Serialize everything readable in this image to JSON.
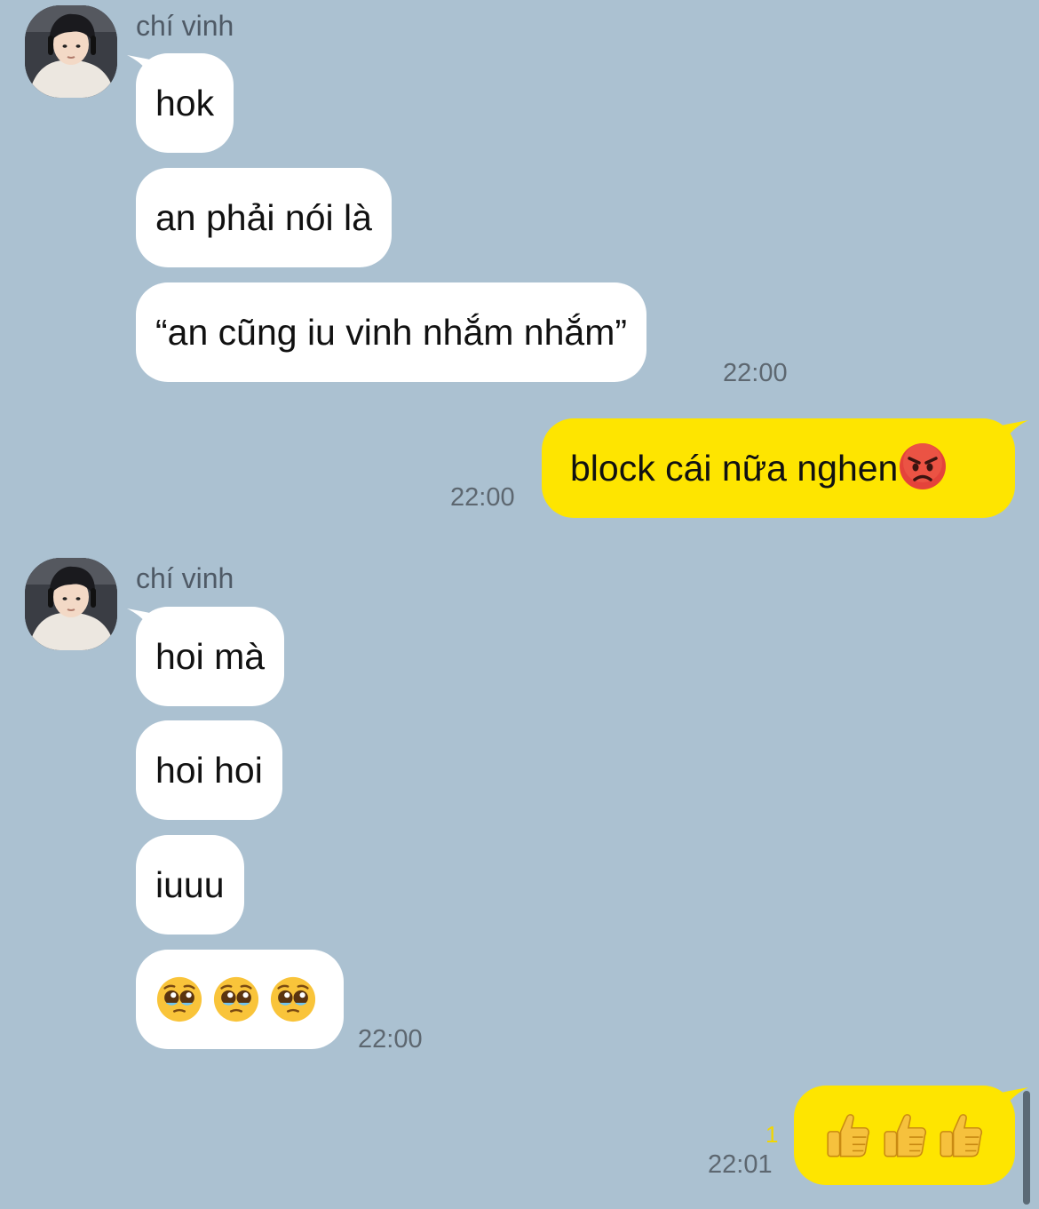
{
  "colors": {
    "background": "#abc1d1",
    "incoming_bubble": "#ffffff",
    "outgoing_bubble": "#fee500",
    "unread_count": "#f2d600"
  },
  "groups": [
    {
      "sender": "chí vinh",
      "avatar": "profile-photo",
      "messages": [
        "hok",
        "an phải nói là",
        "“an cũng iu vinh nhắm nhắm”"
      ],
      "time": "22:00"
    },
    {
      "outgoing": true,
      "message_text": "block cái nữa nghen",
      "message_emoji": "pouting-face-emoji",
      "time": "22:00"
    },
    {
      "sender": "chí vinh",
      "avatar": "profile-photo",
      "messages": [
        "hoi mà",
        "hoi hoi",
        "iuuu"
      ],
      "emoji_message": [
        "pleading-face-emoji",
        "pleading-face-emoji",
        "pleading-face-emoji"
      ],
      "time": "22:00"
    },
    {
      "outgoing": true,
      "emoji_message": [
        "thumbs-up-emoji",
        "thumbs-up-emoji",
        "thumbs-up-emoji"
      ],
      "unread": "1",
      "time": "22:01"
    }
  ]
}
